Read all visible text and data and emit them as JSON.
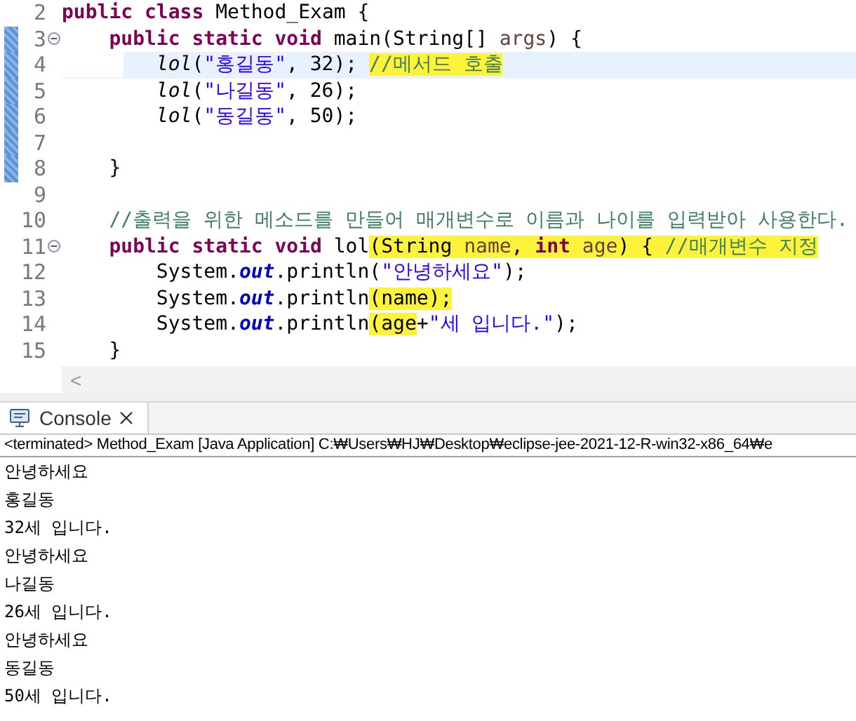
{
  "editor": {
    "lines": [
      {
        "number": "2",
        "fold": false,
        "changed": false,
        "current": false,
        "tokens": [
          {
            "text": "public class",
            "kind": "keyword",
            "marked": false
          },
          {
            "text": " Method_Exam {",
            "kind": "plain",
            "marked": false
          }
        ]
      },
      {
        "number": "3",
        "fold": true,
        "changed": true,
        "current": false,
        "tokens": [
          {
            "text": "    public static void",
            "kind": "keyword",
            "marked": false
          },
          {
            "text": " main(String[] ",
            "kind": "plain",
            "marked": false
          },
          {
            "text": "args",
            "kind": "param",
            "marked": false
          },
          {
            "text": ") {",
            "kind": "plain",
            "marked": false
          }
        ]
      },
      {
        "number": "4",
        "fold": false,
        "changed": true,
        "current": true,
        "tokens": [
          {
            "text": "        lol",
            "kind": "call",
            "marked": false
          },
          {
            "text": "(",
            "kind": "plain",
            "marked": false
          },
          {
            "text": "\"홍길동\"",
            "kind": "string",
            "marked": false
          },
          {
            "text": ", 32); ",
            "kind": "plain",
            "marked": false
          },
          {
            "text": "//메서드 호출",
            "kind": "comment",
            "marked": true
          }
        ]
      },
      {
        "number": "5",
        "fold": false,
        "changed": true,
        "current": false,
        "tokens": [
          {
            "text": "        lol",
            "kind": "call",
            "marked": false
          },
          {
            "text": "(",
            "kind": "plain",
            "marked": false
          },
          {
            "text": "\"나길동\"",
            "kind": "string",
            "marked": false
          },
          {
            "text": ", 26);",
            "kind": "plain",
            "marked": false
          }
        ]
      },
      {
        "number": "6",
        "fold": false,
        "changed": true,
        "current": false,
        "tokens": [
          {
            "text": "        lol",
            "kind": "call",
            "marked": false
          },
          {
            "text": "(",
            "kind": "plain",
            "marked": false
          },
          {
            "text": "\"동길동\"",
            "kind": "string",
            "marked": false
          },
          {
            "text": ", 50);",
            "kind": "plain",
            "marked": false
          }
        ]
      },
      {
        "number": "7",
        "fold": false,
        "changed": true,
        "current": false
      },
      {
        "number": "8",
        "fold": false,
        "changed": true,
        "current": false,
        "tokens": [
          {
            "text": "    }",
            "kind": "plain",
            "marked": false
          }
        ]
      },
      {
        "number": "9",
        "fold": false,
        "changed": false,
        "current": false
      },
      {
        "number": "10",
        "fold": false,
        "changed": false,
        "current": false,
        "tokens": [
          {
            "text": "    //출력을 위한 메소드를 만들어 매개변수로 이름과 나이를 입력받아 사용한다.",
            "kind": "comment",
            "marked": false
          }
        ]
      },
      {
        "number": "11",
        "fold": true,
        "changed": false,
        "current": false,
        "tokens": [
          {
            "text": "    public static void",
            "kind": "keyword",
            "marked": false
          },
          {
            "text": " lol",
            "kind": "plain",
            "marked": false
          },
          {
            "text": "(String ",
            "kind": "plain",
            "marked": true
          },
          {
            "text": "name",
            "kind": "param",
            "marked": true
          },
          {
            "text": ", ",
            "kind": "plain",
            "marked": true
          },
          {
            "text": "int ",
            "kind": "keyword",
            "marked": true
          },
          {
            "text": "age",
            "kind": "param",
            "marked": true
          },
          {
            "text": ") { ",
            "kind": "plain",
            "marked": true
          },
          {
            "text": "//매개변수 지정",
            "kind": "comment",
            "marked": true
          }
        ]
      },
      {
        "number": "12",
        "fold": false,
        "changed": false,
        "current": false,
        "tokens": [
          {
            "text": "        System.",
            "kind": "plain",
            "marked": false
          },
          {
            "text": "out",
            "kind": "field",
            "marked": false
          },
          {
            "text": ".println(",
            "kind": "plain",
            "marked": false
          },
          {
            "text": "\"안녕하세요\"",
            "kind": "string",
            "marked": false
          },
          {
            "text": ");",
            "kind": "plain",
            "marked": false
          }
        ]
      },
      {
        "number": "13",
        "fold": false,
        "changed": false,
        "current": false,
        "tokens": [
          {
            "text": "        System.",
            "kind": "plain",
            "marked": false
          },
          {
            "text": "out",
            "kind": "field",
            "marked": false
          },
          {
            "text": ".println",
            "kind": "plain",
            "marked": false
          },
          {
            "text": "(name);",
            "kind": "plain",
            "marked": true
          }
        ]
      },
      {
        "number": "14",
        "fold": false,
        "changed": false,
        "current": false,
        "tokens": [
          {
            "text": "        System.",
            "kind": "plain",
            "marked": false
          },
          {
            "text": "out",
            "kind": "field",
            "marked": false
          },
          {
            "text": ".println",
            "kind": "plain",
            "marked": false
          },
          {
            "text": "(age",
            "kind": "plain",
            "marked": true
          },
          {
            "text": "+",
            "kind": "plain",
            "marked": false
          },
          {
            "text": "\"세 입니다.\"",
            "kind": "string",
            "marked": false
          },
          {
            "text": ");",
            "kind": "plain",
            "marked": false
          }
        ]
      },
      {
        "number": "15",
        "fold": false,
        "changed": false,
        "current": false,
        "tokens": [
          {
            "text": "    }",
            "kind": "plain",
            "marked": false
          }
        ]
      }
    ],
    "scroll_arrow": "<"
  },
  "console": {
    "tabs": [
      {
        "label": "Console",
        "selected": true
      }
    ],
    "status": "<terminated> Method_Exam [Java Application] C:₩Users₩HJ₩Desktop₩eclipse-jee-2021-12-R-win32-x86_64₩e",
    "output": [
      "안녕하세요",
      "홍길동",
      "32세 입니다.",
      "안녕하세요",
      "나길동",
      "26세 입니다.",
      "안녕하세요",
      "동길동",
      "50세 입니다."
    ]
  }
}
